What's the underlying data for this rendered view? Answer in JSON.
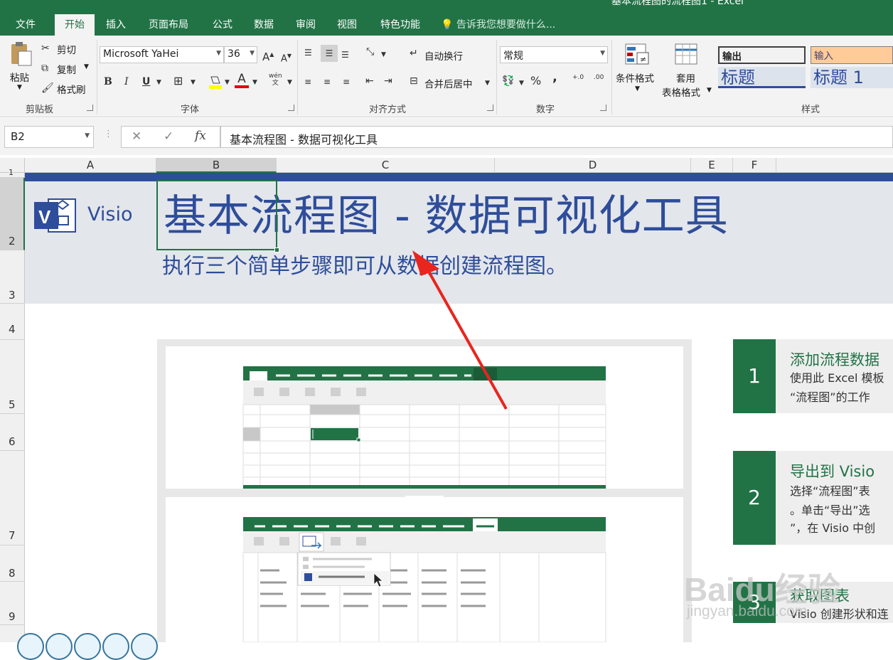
{
  "window": {
    "title": "基本流程图的流程图1 - Excel"
  },
  "tabs": [
    {
      "label": "文件"
    },
    {
      "label": "开始"
    },
    {
      "label": "插入"
    },
    {
      "label": "页面布局"
    },
    {
      "label": "公式"
    },
    {
      "label": "数据"
    },
    {
      "label": "审阅"
    },
    {
      "label": "视图"
    },
    {
      "label": "特色功能"
    }
  ],
  "active_tab": "开始",
  "tell_me": {
    "placeholder": "告诉我您想要做什么..."
  },
  "clipboard": {
    "paste": "粘贴",
    "cut": "剪切",
    "copy": "复制",
    "format_painter": "格式刷",
    "group": "剪贴板"
  },
  "font": {
    "name": "Microsoft YaHei",
    "size": "36",
    "grow": "A",
    "shrink": "A",
    "bold": "B",
    "italic": "I",
    "underline": "U",
    "color_glyph": "A",
    "pinyin": "wén",
    "group": "字体"
  },
  "alignment": {
    "wrap": "自动换行",
    "merge": "合并后居中",
    "group": "对齐方式"
  },
  "number": {
    "format": "常规",
    "percent": "%",
    "comma": ",",
    "inc_decimal": "+.0",
    "dec_decimal": ".00",
    "group": "数字"
  },
  "styles": {
    "conditional": "条件格式",
    "table_line1": "套用",
    "table_line2": "表格格式",
    "output": "输出",
    "input": "输入",
    "heading": "标题",
    "heading1": "标题 1",
    "group": "样式"
  },
  "formula_bar": {
    "name_box": "B2",
    "cancel": "✕",
    "enter": "✓",
    "fx": "fx",
    "value": "基本流程图 - 数据可视化工具"
  },
  "columns": [
    "A",
    "B",
    "C",
    "D",
    "E",
    "F"
  ],
  "rows": [
    "1",
    "2",
    "3",
    "4",
    "5",
    "6",
    "7",
    "8",
    "9"
  ],
  "sheet": {
    "visio_label": "Visio",
    "visio_logo": "V",
    "title": "基本流程图 - 数据可视化工具",
    "subtitle": "执行三个简单步骤即可从数据创建流程图。"
  },
  "steps": [
    {
      "number": "1",
      "title": "添加流程数据",
      "desc": [
        "使用此 Excel 模板",
        "“流程图”的工作"
      ]
    },
    {
      "number": "2",
      "title": "导出到 Visio",
      "desc": [
        "选择“流程图”表",
        "。单击“导出”选",
        "”，在 Visio 中创"
      ]
    },
    {
      "number": "3",
      "title": "获取图表",
      "desc": [
        "Visio 创建形状和连"
      ]
    }
  ],
  "watermark": {
    "text": "Baidu经验",
    "sub": "jingyan.baidu.com"
  },
  "colors": {
    "excel_green": "#217346",
    "visio_blue": "#2e4d9a",
    "band_gray": "#e3e6eb",
    "arrow_red": "#e8251f"
  }
}
